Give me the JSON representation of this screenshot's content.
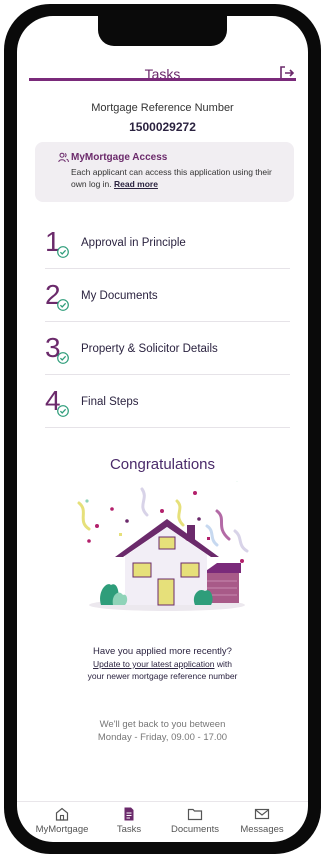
{
  "header": {
    "title": "Tasks"
  },
  "mortgage": {
    "label": "Mortgage Reference Number",
    "number": "1500029272"
  },
  "access": {
    "title": "MyMortgage Access",
    "text": "Each applicant can access this application using their own log in.",
    "link": "Read more"
  },
  "steps": [
    {
      "number": "1",
      "label": "Approval in Principle",
      "status": "complete"
    },
    {
      "number": "2",
      "label": "My Documents",
      "status": "complete"
    },
    {
      "number": "3",
      "label": "Property & Solicitor Details",
      "status": "complete"
    },
    {
      "number": "4",
      "label": "Final Steps",
      "status": "complete"
    }
  ],
  "congrats": {
    "title": "Congratulations"
  },
  "recent": {
    "question": "Have you applied more recently?",
    "link": "Update to your latest application",
    "link_suffix": " with",
    "subtext": "your newer mortgage reference number"
  },
  "hours": {
    "line1": "We'll get back to you between",
    "line2": "Monday - Friday, 09.00 - 17.00"
  },
  "tabs": [
    {
      "label": "MyMortgage",
      "icon": "home-icon"
    },
    {
      "label": "Tasks",
      "icon": "document-icon",
      "active": true
    },
    {
      "label": "Documents",
      "icon": "folder-icon"
    },
    {
      "label": "Messages",
      "icon": "envelope-icon"
    }
  ],
  "colors": {
    "brand": "#6b2a6b",
    "check": "#2e9d7a",
    "card": "#f1eef2"
  }
}
